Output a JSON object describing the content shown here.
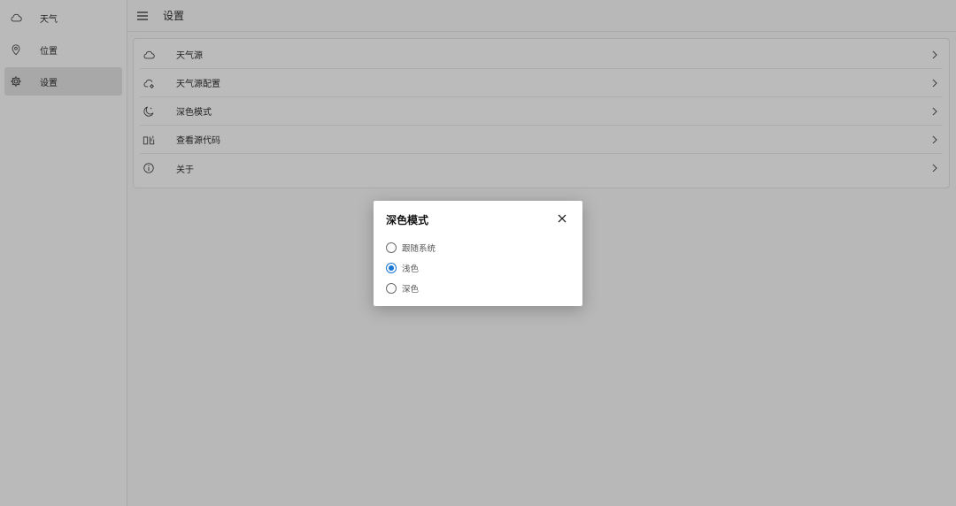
{
  "sidebar": {
    "items": [
      {
        "label": "天气",
        "icon": "cloud-icon",
        "selected": false
      },
      {
        "label": "位置",
        "icon": "location-pin-icon",
        "selected": false
      },
      {
        "label": "设置",
        "icon": "gear-icon",
        "selected": true
      }
    ]
  },
  "header": {
    "title": "设置",
    "menu_icon": "hamburger-menu-icon"
  },
  "settings": {
    "items": [
      {
        "label": "天气源",
        "icon": "cloud-icon"
      },
      {
        "label": "天气源配置",
        "icon": "cloud-settings-icon"
      },
      {
        "label": "深色模式",
        "icon": "moon-icon"
      },
      {
        "label": "查看源代码",
        "icon": "source-code-icon"
      },
      {
        "label": "关于",
        "icon": "info-icon"
      }
    ]
  },
  "dialog": {
    "title": "深色模式",
    "options": [
      {
        "label": "跟随系统",
        "checked": false
      },
      {
        "label": "浅色",
        "checked": true
      },
      {
        "label": "深色",
        "checked": false
      }
    ]
  },
  "colors": {
    "accent": "#1976d2",
    "overlay_bg": "#b8b8b8",
    "dialog_bg": "#ffffff"
  }
}
